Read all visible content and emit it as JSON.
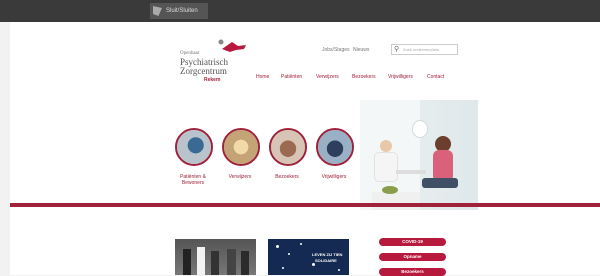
{
  "browser": {
    "tab_label": "Sluit/Sluiten"
  },
  "logo": {
    "line1": "Openbaar",
    "line2": "Psychiatrisch",
    "line3": "Zorgcentrum",
    "line4": "Rekem"
  },
  "util": {
    "contact_link": "Jobs/Stages",
    "nieuws_link": "Nieuws",
    "search_placeholder": "Zoek onderwerp/iets"
  },
  "nav": [
    "Home",
    "Patiënten",
    "Verwijzers",
    "Bezoekers",
    "Vrijwilligers",
    "Contact"
  ],
  "circles": [
    {
      "label_1": "Patiënten &",
      "label_2": "Bewoners"
    },
    {
      "label_1": "Verwijzers",
      "label_2": ""
    },
    {
      "label_1": "Bezoekers",
      "label_2": ""
    },
    {
      "label_1": "Vrijwilligers",
      "label_2": ""
    }
  ],
  "news": {
    "poster_line1": "LEVEN ZIJ TIEN",
    "poster_line2": "SOLIDAIRE"
  },
  "buttons": [
    "COVID-19",
    "Opname",
    "Bezoekers"
  ],
  "colors": {
    "brand": "#a0213a",
    "pill": "#b81a3e",
    "topbar": "#3a3a3a"
  }
}
